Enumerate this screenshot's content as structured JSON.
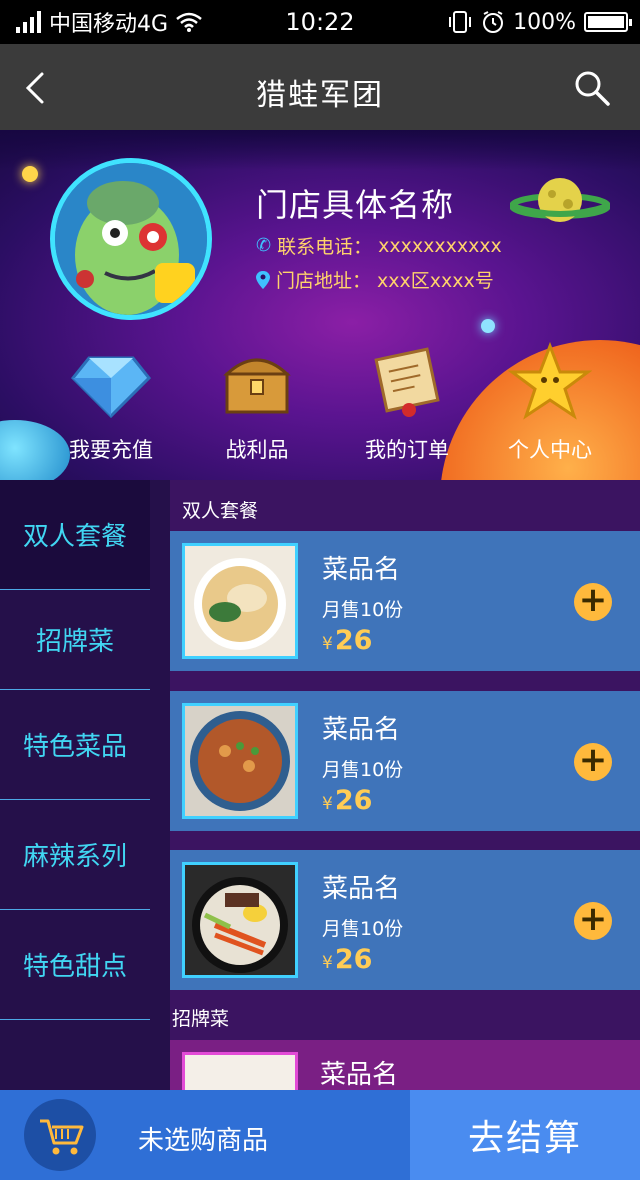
{
  "status_bar": {
    "carrier": "中国移动4G",
    "time": "10:22",
    "battery": "100%"
  },
  "nav": {
    "title": "猎蛙军团"
  },
  "store": {
    "name": "门店具体名称",
    "phone_label": "联系电话：",
    "phone_value": "xxxxxxxxxxx",
    "address_label": "门店地址：",
    "address_value": "xxx区xxxx号"
  },
  "features": [
    {
      "label": "我要充值",
      "icon": "diamond-icon"
    },
    {
      "label": "战利品",
      "icon": "treasure-chest-icon"
    },
    {
      "label": "我的订单",
      "icon": "scroll-icon"
    },
    {
      "label": "个人中心",
      "icon": "star-icon"
    }
  ],
  "categories": [
    "双人套餐",
    "招牌菜",
    "特色菜品",
    "麻辣系列",
    "特色甜点"
  ],
  "sections": [
    {
      "title": "双人套餐",
      "items": [
        {
          "name": "菜品名",
          "sales": "月售10份",
          "currency": "¥",
          "price": "26"
        },
        {
          "name": "菜品名",
          "sales": "月售10份",
          "currency": "¥",
          "price": "26"
        },
        {
          "name": "菜品名",
          "sales": "月售10份",
          "currency": "¥",
          "price": "26"
        }
      ]
    },
    {
      "title": "招牌菜",
      "items": [
        {
          "name": "菜品名"
        }
      ]
    }
  ],
  "cart": {
    "empty_text": "未选购商品",
    "checkout_label": "去结算"
  },
  "colors": {
    "accent_cyan": "#41d6f2",
    "price_yellow": "#ffcc55",
    "card_blue": "#3f74ba",
    "checkout_blue": "#4a8cf0"
  }
}
